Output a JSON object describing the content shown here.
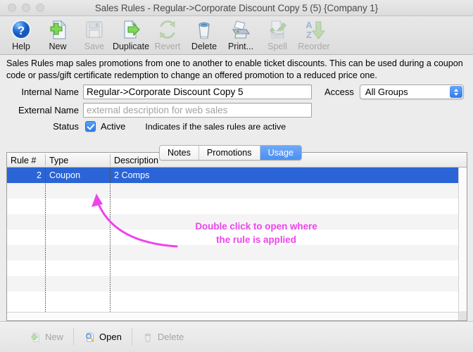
{
  "window": {
    "title": "Sales Rules - Regular->Corporate Discount Copy 5 (5) {Company 1}",
    "traffic_lights": [
      "close-button",
      "minimize-button",
      "zoom-button"
    ]
  },
  "toolbar": {
    "items": [
      {
        "label": "Help",
        "icon": "help-icon",
        "enabled": true
      },
      {
        "label": "New",
        "icon": "new-document-icon",
        "enabled": true
      },
      {
        "label": "Save",
        "icon": "save-floppy-icon",
        "enabled": false
      },
      {
        "label": "Duplicate",
        "icon": "duplicate-icon",
        "enabled": true
      },
      {
        "label": "Revert",
        "icon": "revert-arrows-icon",
        "enabled": false
      },
      {
        "label": "Delete",
        "icon": "trash-icon",
        "enabled": true
      },
      {
        "label": "Print...",
        "icon": "printer-icon",
        "enabled": true
      },
      {
        "label": "Spell",
        "icon": "spell-check-icon",
        "enabled": false
      },
      {
        "label": "Reorder",
        "icon": "sort-az-icon",
        "enabled": false
      }
    ]
  },
  "description": "Sales Rules map sales promotions from one to another to enable ticket discounts.  This can be used during a coupon code or pass/gift certificate redemption to change an offered promotion to a reduced price one.",
  "form": {
    "internal_name_label": "Internal Name",
    "internal_name_value": "Regular->Corporate Discount Copy 5",
    "external_name_label": "External Name",
    "external_name_value": "",
    "external_name_placeholder": "external description for web sales",
    "status_label": "Status",
    "status_checkbox_label": "Active",
    "status_checked": true,
    "status_hint": "Indicates if the sales rules are active",
    "access_label": "Access",
    "access_value": "All Groups"
  },
  "tabs": [
    {
      "label": "Notes",
      "active": false
    },
    {
      "label": "Promotions",
      "active": false
    },
    {
      "label": "Usage",
      "active": true
    }
  ],
  "table": {
    "columns": [
      "Rule #",
      "Type",
      "Description"
    ],
    "rows": [
      {
        "rule": "2",
        "type": "Coupon",
        "description": "2 Comps",
        "selected": true
      }
    ],
    "empty_row_count": 8
  },
  "annotation": {
    "line1": "Double click to open where",
    "line2": "the rule is applied",
    "color": "#ee44ee"
  },
  "bottom_bar": {
    "buttons": [
      {
        "label": "New",
        "icon": "new-document-icon",
        "enabled": false
      },
      {
        "label": "Open",
        "icon": "magnifier-icon",
        "enabled": true
      },
      {
        "label": "Delete",
        "icon": "trash-icon",
        "enabled": false
      }
    ]
  },
  "colors": {
    "accent_blue": "#2f7ced",
    "selection_blue": "#2a64d6",
    "annotation_pink": "#ee44ee",
    "window_chrome": "#ececec"
  }
}
